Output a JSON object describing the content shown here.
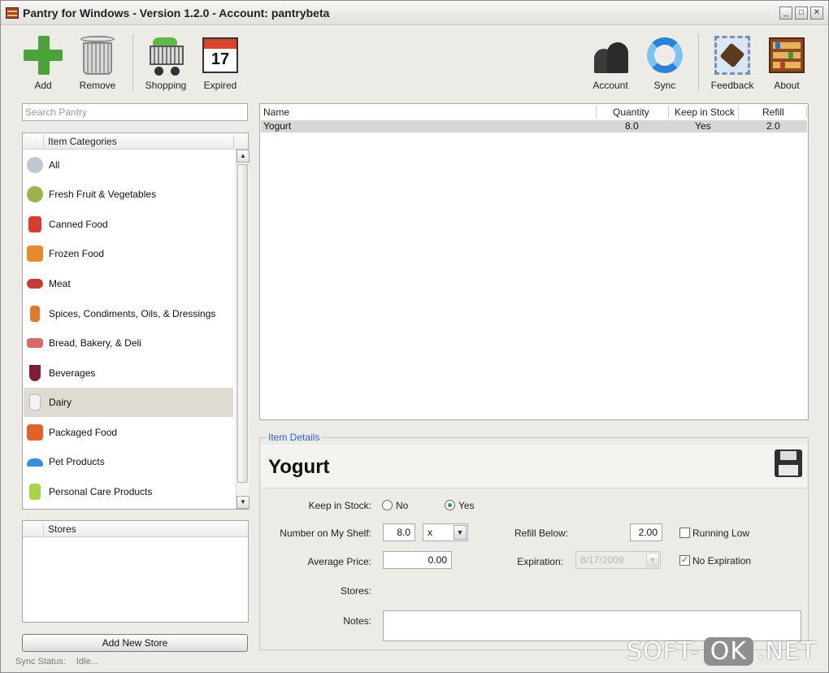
{
  "window": {
    "title": "Pantry for Windows - Version 1.2.0 - Account: pantrybeta",
    "minimize": "_",
    "maximize": "□",
    "close": "✕"
  },
  "toolbar": {
    "add_label": "Add",
    "remove_label": "Remove",
    "shopping_label": "Shopping",
    "expired_label": "Expired",
    "expired_day": "17",
    "account_label": "Account",
    "sync_label": "Sync",
    "feedback_label": "Feedback",
    "about_label": "About"
  },
  "search": {
    "placeholder": "Search Pantry"
  },
  "categories": {
    "header": "Item Categories",
    "items": [
      {
        "label": "All",
        "icon": "magnifier-icon",
        "color": "#bfc8d0"
      },
      {
        "label": "Fresh Fruit & Vegetables",
        "icon": "kiwi-icon",
        "color": "#9bb34a"
      },
      {
        "label": "Canned Food",
        "icon": "can-icon",
        "color": "#d93b2e"
      },
      {
        "label": "Frozen Food",
        "icon": "frozen-food-icon",
        "color": "#e58b2c"
      },
      {
        "label": "Meat",
        "icon": "meat-icon",
        "color": "#c73b35"
      },
      {
        "label": "Spices, Condiments, Oils, & Dressings",
        "icon": "spice-bottle-icon",
        "color": "#e07a2a"
      },
      {
        "label": "Bread, Bakery, & Deli",
        "icon": "bread-icon",
        "color": "#d96a6a"
      },
      {
        "label": "Beverages",
        "icon": "wine-glass-icon",
        "color": "#7a1f35"
      },
      {
        "label": "Dairy",
        "icon": "milk-glass-icon",
        "color": "#f2f2f2"
      },
      {
        "label": "Packaged Food",
        "icon": "package-icon",
        "color": "#e2632a"
      },
      {
        "label": "Pet Products",
        "icon": "pet-bowl-icon",
        "color": "#3b8fd8"
      },
      {
        "label": "Personal Care Products",
        "icon": "lotion-bottle-icon",
        "color": "#a8d44a"
      }
    ],
    "selected_index": 8
  },
  "stores": {
    "header": "Stores",
    "add_button": "Add New Store"
  },
  "status": {
    "label": "Sync Status:",
    "value": "Idle..."
  },
  "list": {
    "columns": [
      "Name",
      "Quantity",
      "Keep in Stock",
      "Refill"
    ],
    "rows": [
      {
        "name": "Yogurt",
        "quantity": "8.0",
        "keep_in_stock": "Yes",
        "refill": "2.0"
      }
    ]
  },
  "details": {
    "legend": "Item Details",
    "item_name": "Yogurt",
    "keep_in_stock_label": "Keep in Stock:",
    "no_label": "No",
    "yes_label": "Yes",
    "keep_in_stock_value": "Yes",
    "shelf_label": "Number on My Shelf:",
    "shelf_value": "8.0",
    "unit_value": "x",
    "refill_label": "Refill Below:",
    "refill_value": "2.00",
    "running_low_label": "Running Low",
    "running_low_checked": false,
    "price_label": "Average Price:",
    "price_value": "0.00",
    "expiration_label": "Expiration:",
    "expiration_value": "8/17/2009",
    "no_expiration_label": "No Expiration",
    "no_expiration_checked": true,
    "stores_label": "Stores:",
    "notes_label": "Notes:",
    "notes_value": ""
  },
  "watermark": {
    "part1": "SOFT-",
    "part2": "OK",
    "part3": ".NET"
  }
}
